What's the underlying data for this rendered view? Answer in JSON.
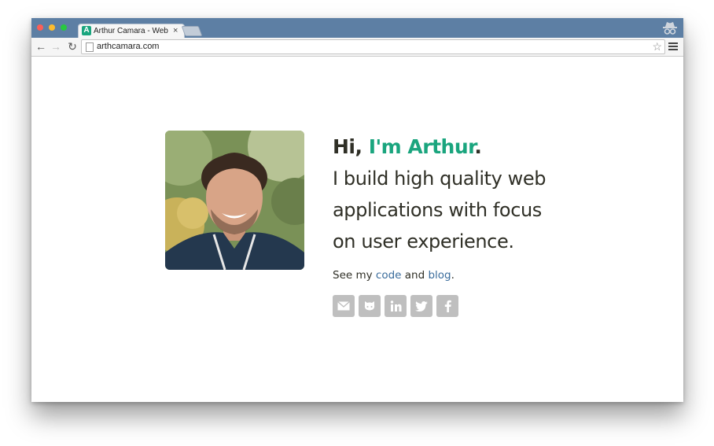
{
  "browser": {
    "tab": {
      "title": "Arthur Camara - Web developer",
      "favicon_letter": "A",
      "close_label": "×"
    },
    "address_bar": {
      "url": "arthcamara.com"
    },
    "nav": {
      "back": "←",
      "forward": "→",
      "reload": "↻"
    },
    "star": "☆"
  },
  "page": {
    "greeting_prefix": "Hi, ",
    "greeting_name": "I'm Arthur",
    "greeting_suffix": ".",
    "tagline_line1": "I build high quality web",
    "tagline_line2": "applications with focus",
    "tagline_line3": "on user experience.",
    "links": {
      "prefix": "See my ",
      "code_label": "code",
      "middle": " and ",
      "blog_label": "blog",
      "suffix": "."
    },
    "social_icons": [
      "email-icon",
      "github-icon",
      "linkedin-icon",
      "twitter-icon",
      "facebook-icon"
    ]
  },
  "colors": {
    "titlebar": "#5d7fa4",
    "accent_green": "#1aa57e",
    "link_blue": "#3a6c9c",
    "text_dark": "#2f2f26",
    "social_gray": "#bfbfbf"
  }
}
